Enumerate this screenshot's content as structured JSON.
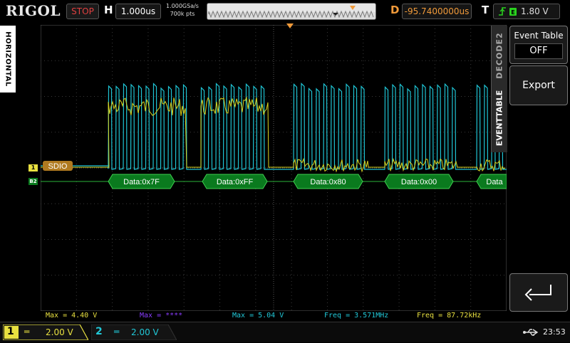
{
  "brand": "RIGOL",
  "run_state": "STOP",
  "horizontal": {
    "label": "H",
    "timebase": "1.000us"
  },
  "sample": {
    "rate": "1.000GSa/s",
    "depth": "700k pts"
  },
  "delay": {
    "label": "D",
    "value": "-95.7400000us"
  },
  "trigger": {
    "label": "T",
    "level": "1.80 V"
  },
  "side_tab": "HORIZONTAL",
  "decode_menu": {
    "title": "DECODE2",
    "subtitle": "EVENTTABLE",
    "event_table_label": "Event Table",
    "event_table_value": "OFF",
    "export_label": "Export"
  },
  "bus": {
    "label": "SDIO",
    "packets": [
      "Data:0x7F",
      "Data:0xFF",
      "Data:0x80",
      "Data:0x00",
      "Data"
    ]
  },
  "markers": {
    "ch1": "1",
    "bus2": "B2"
  },
  "measurements": [
    {
      "text": "Max = 4.40 V",
      "color": "#e8e040"
    },
    {
      "text": "Max = ****",
      "color": "#8a3cff"
    },
    {
      "text": "Max = 5.04 V",
      "color": "#21c8d8"
    },
    {
      "text": "Freq = 3.571MHz",
      "color": "#21c8d8"
    },
    {
      "text": "Freq = 87.72kHz",
      "color": "#e8e040"
    }
  ],
  "channels": [
    {
      "num": "1",
      "coupling": "═",
      "scale": "2.00 V",
      "color": "#f0e020"
    },
    {
      "num": "2",
      "coupling": "═",
      "scale": "2.00 V",
      "color": "#21c8d8"
    }
  ],
  "clock": "23:53",
  "colors": {
    "ch1": "#d8d420",
    "ch2": "#1fc4d4",
    "bus": "#0a7a1e",
    "bus_label": "#b07a20",
    "accent": "#f09a3a"
  }
}
